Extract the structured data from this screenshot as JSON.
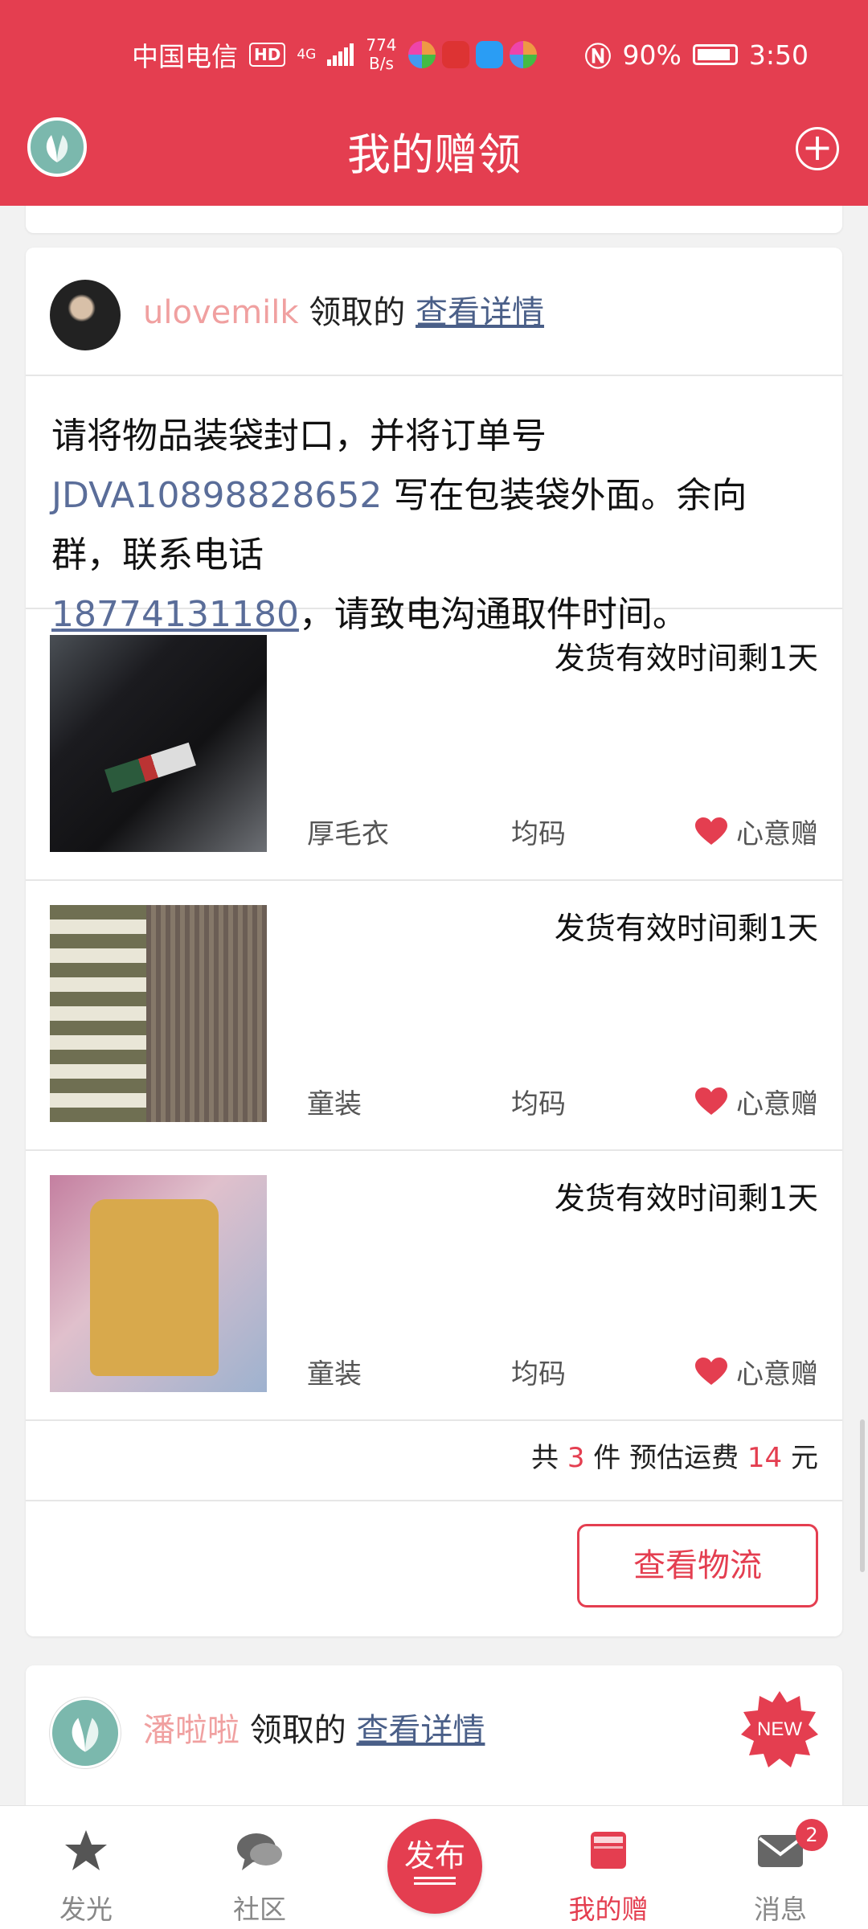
{
  "status_bar": {
    "carrier": "中国电信",
    "hd": "HD",
    "network": "4G",
    "speed_value": "774",
    "speed_unit": "B/s",
    "battery": "90%",
    "time": "3:50"
  },
  "header": {
    "title": "我的赠领",
    "add_icon": "plus-circle-icon"
  },
  "order": {
    "username": "ulovemilk",
    "received_text": "领取的",
    "detail_link": "查看详情",
    "message_part1": "请将物品装袋封口，并将订单号",
    "order_no": "JDVA10898828652",
    "message_part2": "写在包装袋外面。余向群，联系电话",
    "phone": "18774131180",
    "message_part3": "，请致电沟通取件时间。",
    "items": [
      {
        "deadline": "发货有效时间剩1天",
        "name": "厚毛衣",
        "size": "均码",
        "tag": "心意赠"
      },
      {
        "deadline": "发货有效时间剩1天",
        "name": "童装",
        "size": "均码",
        "tag": "心意赠"
      },
      {
        "deadline": "发货有效时间剩1天",
        "name": "童装",
        "size": "均码",
        "tag": "心意赠"
      }
    ],
    "summary": {
      "prefix": "共",
      "count": "3",
      "count_unit": "件 预估运费",
      "fee": "14",
      "fee_unit": "元"
    },
    "logistics_button": "查看物流"
  },
  "next_order": {
    "username": "潘啦啦",
    "received_text": "领取的",
    "detail_link": "查看详情",
    "badge": "NEW"
  },
  "tabbar": {
    "tabs": [
      {
        "label": "发光",
        "icon": "star-icon"
      },
      {
        "label": "社区",
        "icon": "chat-bubbles-icon"
      },
      {
        "label": "发布",
        "icon": "publish-icon"
      },
      {
        "label": "我的赠领",
        "icon": "gift-box-icon"
      },
      {
        "label": "消息",
        "icon": "mail-icon",
        "badge": "2"
      }
    ],
    "active": "我的赠领"
  },
  "colors": {
    "brand": "#e43e50",
    "link": "#4a5f88",
    "username": "#f0a0a0"
  }
}
